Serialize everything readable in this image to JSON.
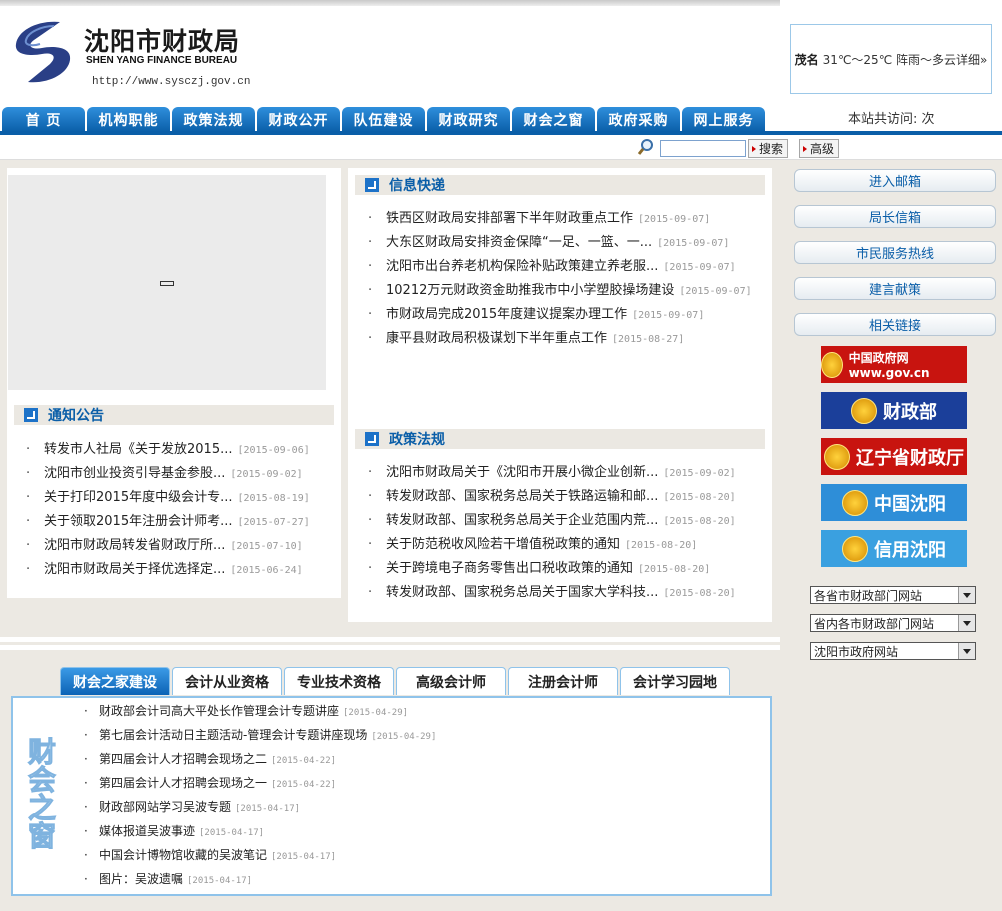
{
  "header": {
    "logo_cn": "沈阳市财政局",
    "logo_en": "SHEN YANG FINANCE BUREAU",
    "url": "http://www.sysczj.gov.cn",
    "weather_city": "茂名",
    "weather_text": "31℃～25℃ 阵雨～多云详细»",
    "visits": "本站共访问: 次"
  },
  "nav": [
    "首 页",
    "机构职能",
    "政策法规",
    "财政公开",
    "队伍建设",
    "财政研究",
    "财会之窗",
    "政府采购",
    "网上服务"
  ],
  "search": {
    "value": "",
    "search_label": "搜索",
    "advanced_label": "高级"
  },
  "notice": {
    "title": "通知公告",
    "items": [
      {
        "text": "转发市人社局《关于发放2015...",
        "date": "[2015-09-06]"
      },
      {
        "text": "沈阳市创业投资引导基金参股...",
        "date": "[2015-09-02]"
      },
      {
        "text": "关于打印2015年度中级会计专...",
        "date": "[2015-08-19]"
      },
      {
        "text": "关于领取2015年注册会计师考...",
        "date": "[2015-07-27]"
      },
      {
        "text": "沈阳市财政局转发省财政厅所...",
        "date": "[2015-07-10]"
      },
      {
        "text": "沈阳市财政局关于择优选择定...",
        "date": "[2015-06-24]"
      }
    ]
  },
  "express": {
    "title": "信息快递",
    "items": [
      {
        "text": "铁西区财政局安排部署下半年财政重点工作",
        "date": "[2015-09-07]"
      },
      {
        "text": "大东区财政局安排资金保障“一足、一篮、一...",
        "date": "[2015-09-07]"
      },
      {
        "text": "沈阳市出台养老机构保险补贴政策建立养老服...",
        "date": "[2015-09-07]"
      },
      {
        "text": "10212万元财政资金助推我市中小学塑胶操场建设",
        "date": "[2015-09-07]"
      },
      {
        "text": "市财政局完成2015年度建议提案办理工作",
        "date": "[2015-09-07]"
      },
      {
        "text": "康平县财政局积极谋划下半年重点工作",
        "date": "[2015-08-27]"
      }
    ]
  },
  "policy": {
    "title": "政策法规",
    "items": [
      {
        "text": "沈阳市财政局关于《沈阳市开展小微企业创新...",
        "date": "[2015-09-02]"
      },
      {
        "text": "转发财政部、国家税务总局关于铁路运输和邮...",
        "date": "[2015-08-20]"
      },
      {
        "text": "转发财政部、国家税务总局关于企业范围内荒...",
        "date": "[2015-08-20]"
      },
      {
        "text": "关于防范税收风险若干增值税政策的通知",
        "date": "[2015-08-20]"
      },
      {
        "text": "关于跨境电子商务零售出口税收政策的通知",
        "date": "[2015-08-20]"
      },
      {
        "text": "转发财政部、国家税务总局关于国家大学科技...",
        "date": "[2015-08-20]"
      }
    ]
  },
  "accounting": {
    "tabs": [
      "财会之家建设",
      "会计从业资格",
      "专业技术资格",
      "高级会计师",
      "注册会计师",
      "会计学习园地"
    ],
    "side_art": "财会之窗",
    "items": [
      {
        "text": "财政部会计司高大平处长作管理会计专题讲座",
        "date": "[2015-04-29]"
      },
      {
        "text": "第七届会计活动日主题活动-管理会计专题讲座现场",
        "date": "[2015-04-29]"
      },
      {
        "text": "第四届会计人才招聘会现场之二",
        "date": "[2015-04-22]"
      },
      {
        "text": "第四届会计人才招聘会现场之一",
        "date": "[2015-04-22]"
      },
      {
        "text": "财政部网站学习吴波专题",
        "date": "[2015-04-17]"
      },
      {
        "text": "媒体报道吴波事迹",
        "date": "[2015-04-17]"
      },
      {
        "text": "中国会计博物馆收藏的吴波笔记",
        "date": "[2015-04-17]"
      },
      {
        "text": "图片：吴波遗嘱",
        "date": "[2015-04-17]"
      }
    ]
  },
  "right": {
    "buttons": [
      "进入邮箱",
      "局长信箱",
      "市民服务热线",
      "建言献策",
      "相关链接"
    ],
    "banners": [
      {
        "text": "中国政府网 www.gov.cn",
        "color": "#c8140f"
      },
      {
        "text": "财政部",
        "color": "#1b3f9a"
      },
      {
        "text": "辽宁省财政厅",
        "color": "#c8140f"
      },
      {
        "text": "中国沈阳",
        "color": "#2e8ed8"
      },
      {
        "text": "信用沈阳",
        "color": "#3aa0e0"
      }
    ],
    "selects": [
      "各省市财政部门网站",
      "省内各市财政部门网站",
      "沈阳市政府网站"
    ]
  }
}
